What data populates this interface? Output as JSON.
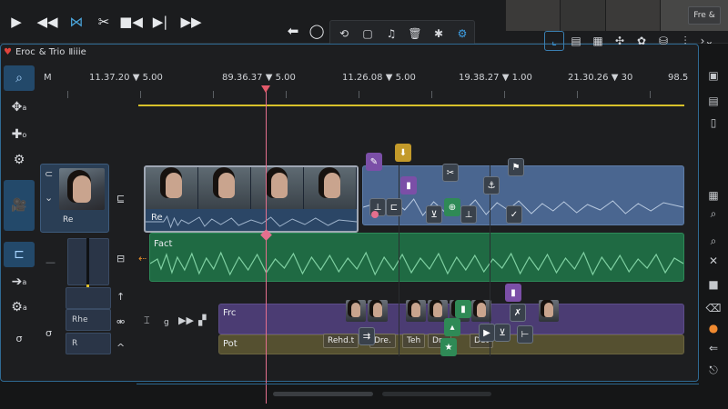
{
  "toolbar": {
    "buttons": [
      "play-icon",
      "rewind-icon",
      "split-icon",
      "cut-icon",
      "record-icon",
      "step-icon",
      "forward-icon"
    ],
    "group": [
      "link-icon",
      "circle-icon",
      "loop-icon",
      "stop-icon",
      "audio-icon",
      "delete-icon",
      "gear-icon",
      "settings-icon"
    ],
    "frame_button": "Fre &"
  },
  "panel": {
    "title": "Eroc",
    "title_extra": "& Trio",
    "title_icon_label": "Ⅱiiie",
    "view_icons": [
      "layout-icon",
      "columns-icon",
      "tags-icon",
      "fx-icon",
      "flower-icon",
      "db-icon",
      "split-view-icon",
      "chevron-icon"
    ]
  },
  "ruler": {
    "timecodes": [
      {
        "label": "11.37.20",
        "marker_value": "5.00"
      },
      {
        "label": "89.36.37",
        "marker_value": "5.00"
      },
      {
        "label": "11.26.08",
        "marker_value": "5.00"
      },
      {
        "label": "19.38.27",
        "marker_value": "1.00"
      },
      {
        "label": "21.30.26",
        "marker_value": "30"
      },
      {
        "label": "",
        "marker_value": "98.5"
      }
    ],
    "left_mark": "M"
  },
  "tracks": {
    "video_header": {
      "label": "Re"
    },
    "video_clip": {
      "label": "Re"
    },
    "audio_clip": {
      "label": "Fact"
    },
    "purple_clip": {
      "label": "Frc"
    },
    "olive_clip": {
      "label": "Pot"
    },
    "chips": [
      "Rehd.t",
      "Dre.",
      "Teh",
      "Dre",
      "Det"
    ],
    "header_cells": [
      "Rhe",
      "R"
    ]
  },
  "colors": {
    "accent": "#3ea0e6",
    "video_clip": "#2b4666",
    "audio_clip": "#1f6a43",
    "purple_clip": "#4b3c73",
    "playhead": "#e46f8e",
    "in_line": "#d8c12a"
  }
}
